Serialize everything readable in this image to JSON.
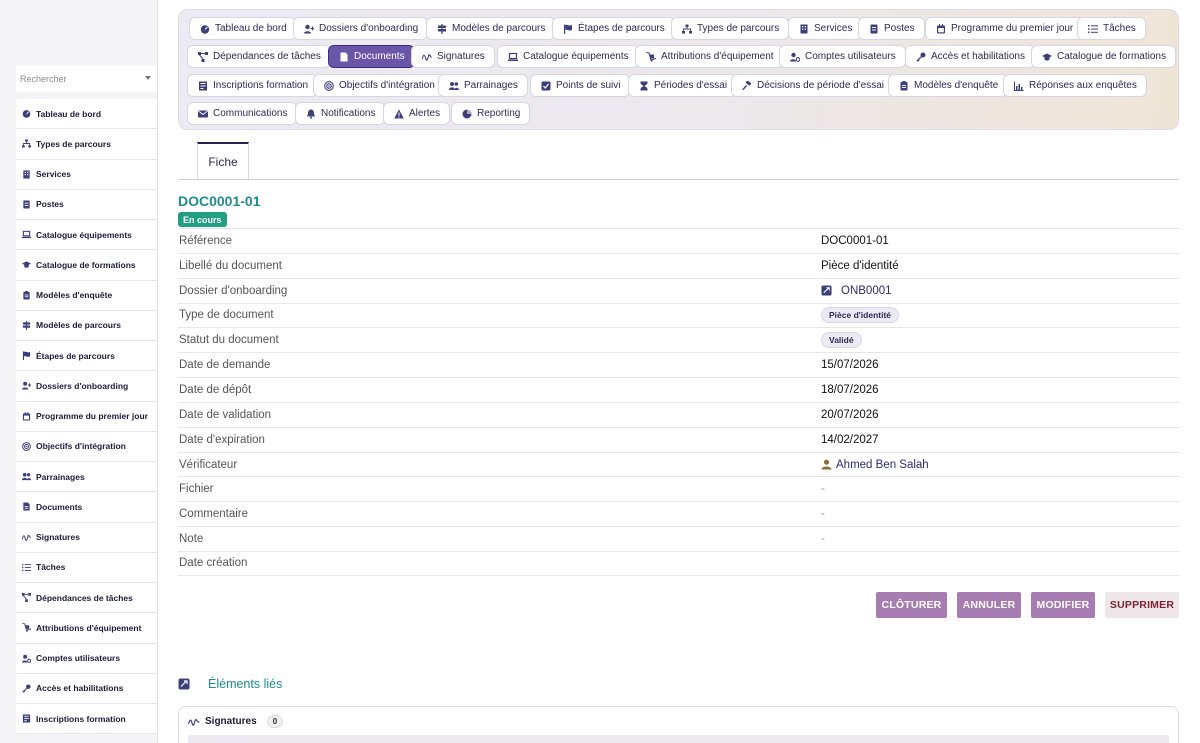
{
  "sidebar": {
    "search_placeholder": "Rechercher",
    "items": [
      {
        "label": "Tableau de bord",
        "icon": "gauge-icon"
      },
      {
        "label": "Types de parcours",
        "icon": "sitemap-icon"
      },
      {
        "label": "Services",
        "icon": "building-icon"
      },
      {
        "label": "Postes",
        "icon": "id-card-icon"
      },
      {
        "label": "Catalogue équipements",
        "icon": "laptop-icon"
      },
      {
        "label": "Catalogue de formations",
        "icon": "graduation-cap-icon"
      },
      {
        "label": "Modèles d'enquête",
        "icon": "clipboard-icon"
      },
      {
        "label": "Modèles de parcours",
        "icon": "signs-icon"
      },
      {
        "label": "Étapes de parcours",
        "icon": "flag-icon"
      },
      {
        "label": "Dossiers d'onboarding",
        "icon": "user-plus-icon"
      },
      {
        "label": "Programme du premier jour",
        "icon": "calendar-icon"
      },
      {
        "label": "Objectifs d'intégration",
        "icon": "target-icon"
      },
      {
        "label": "Parrainages",
        "icon": "users-icon"
      },
      {
        "label": "Documents",
        "icon": "document-icon"
      },
      {
        "label": "Signatures",
        "icon": "signature-icon"
      },
      {
        "label": "Tâches",
        "icon": "list-icon"
      },
      {
        "label": "Dépendances de tâches",
        "icon": "diagram-icon"
      },
      {
        "label": "Attributions d'équipement",
        "icon": "dolly-icon"
      },
      {
        "label": "Comptes utilisateurs",
        "icon": "user-gear-icon"
      },
      {
        "label": "Accès et habilitations",
        "icon": "key-icon"
      },
      {
        "label": "Inscriptions formation",
        "icon": "form-icon"
      }
    ]
  },
  "tabs": [
    {
      "label": "Tableau de bord",
      "icon": "gauge-icon"
    },
    {
      "label": "Dossiers d'onboarding",
      "icon": "user-plus-icon"
    },
    {
      "label": "Modèles de parcours",
      "icon": "signs-icon"
    },
    {
      "label": "Étapes de parcours",
      "icon": "flag-icon"
    },
    {
      "label": "Types de parcours",
      "icon": "sitemap-icon"
    },
    {
      "label": "Services",
      "icon": "building-icon"
    },
    {
      "label": "Postes",
      "icon": "id-card-icon"
    },
    {
      "label": "Programme du premier jour",
      "icon": "calendar-icon"
    },
    {
      "label": "Tâches",
      "icon": "list-icon"
    },
    {
      "label": "Dépendances de tâches",
      "icon": "diagram-icon"
    },
    {
      "label": "Documents",
      "icon": "document-icon",
      "active": true
    },
    {
      "label": "Signatures",
      "icon": "signature-icon"
    },
    {
      "label": "Catalogue équipements",
      "icon": "laptop-icon"
    },
    {
      "label": "Attributions d'équipement",
      "icon": "dolly-icon"
    },
    {
      "label": "Comptes utilisateurs",
      "icon": "user-gear-icon"
    },
    {
      "label": "Accès et habilitations",
      "icon": "key-icon"
    },
    {
      "label": "Catalogue de formations",
      "icon": "graduation-cap-icon"
    },
    {
      "label": "Inscriptions formation",
      "icon": "form-icon"
    },
    {
      "label": "Objectifs d'intégration",
      "icon": "target-icon"
    },
    {
      "label": "Parrainages",
      "icon": "users-icon"
    },
    {
      "label": "Points de suivi",
      "icon": "checkbox-icon"
    },
    {
      "label": "Périodes d'essai",
      "icon": "hourglass-icon"
    },
    {
      "label": "Décisions de période d'essai",
      "icon": "gavel-icon"
    },
    {
      "label": "Modèles d'enquête",
      "icon": "clipboard-icon"
    },
    {
      "label": "Réponses aux enquêtes",
      "icon": "chart-icon"
    },
    {
      "label": "Communications",
      "icon": "envelope-icon"
    },
    {
      "label": "Notifications",
      "icon": "bell-icon"
    },
    {
      "label": "Alertes",
      "icon": "warning-icon"
    },
    {
      "label": "Reporting",
      "icon": "pie-chart-icon"
    }
  ],
  "detail_tab": {
    "label": "Fiche"
  },
  "record": {
    "title": "DOC0001-01",
    "status": "En cours",
    "fields": [
      {
        "label": "Référence",
        "value": "DOC0001-01",
        "kind": "text"
      },
      {
        "label": "Libellé du document",
        "value": "Pièce d'identité",
        "kind": "text"
      },
      {
        "label": "Dossier d'onboarding",
        "value": "ONB0001",
        "kind": "link",
        "icon": "record-link-icon"
      },
      {
        "label": "Type de document",
        "value": "Pièce d'identité",
        "kind": "badge"
      },
      {
        "label": "Statut du document",
        "value": "Validé",
        "kind": "badge"
      },
      {
        "label": "Date de demande",
        "value": "15/07/2026",
        "kind": "text"
      },
      {
        "label": "Date de dépôt",
        "value": "18/07/2026",
        "kind": "text"
      },
      {
        "label": "Date de validation",
        "value": "20/07/2026",
        "kind": "text"
      },
      {
        "label": "Date d'expiration",
        "value": "14/02/2027",
        "kind": "text"
      },
      {
        "label": "Vérificateur",
        "value": "Ahmed Ben Salah",
        "kind": "link",
        "icon": "user-icon"
      },
      {
        "label": "Fichier",
        "value": "-",
        "kind": "empty"
      },
      {
        "label": "Commentaire",
        "value": "-",
        "kind": "empty"
      },
      {
        "label": "Note",
        "value": "-",
        "kind": "empty"
      },
      {
        "label": "Date création",
        "value": "",
        "kind": "empty"
      }
    ]
  },
  "actions": {
    "close_label": "CLÔTURER",
    "cancel_label": "ANNULER",
    "edit_label": "MODIFIER",
    "delete_label": "SUPPRIMER"
  },
  "related": {
    "title": "Éléments liés",
    "signatures": {
      "label": "Signatures",
      "count": "0"
    }
  },
  "colors": {
    "accent": "#6a56a8",
    "title_teal": "#1e8d8f",
    "status_green": "#20a080",
    "action_purple": "#a77cb1",
    "danger_bg": "#efe6ea",
    "danger_text": "#7b2430"
  }
}
